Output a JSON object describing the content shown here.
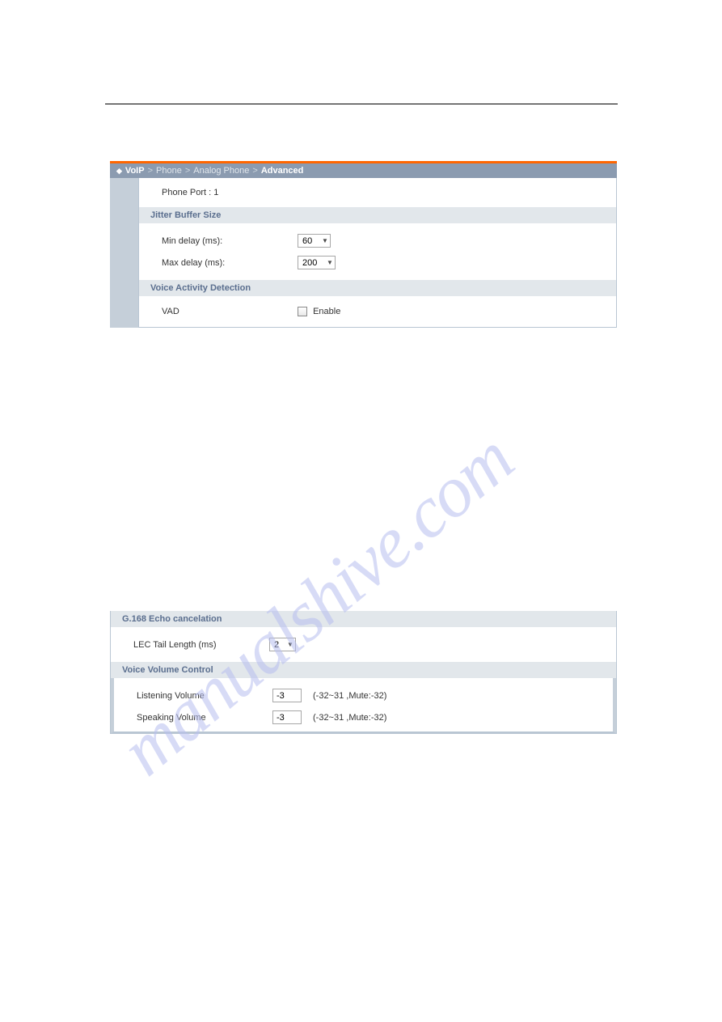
{
  "watermark": "manualshive.com",
  "breadcrumb": {
    "diamond": "◆",
    "seg1": "VoIP",
    "sep": ">",
    "seg2": "Phone",
    "seg3": "Analog Phone",
    "seg4": "Advanced"
  },
  "phone_port": {
    "label": "Phone Port : 1"
  },
  "sections": {
    "jitter": {
      "title": "Jitter Buffer Size",
      "min_delay_label": "Min delay (ms):",
      "min_delay_value": "60",
      "max_delay_label": "Max delay (ms):",
      "max_delay_value": "200"
    },
    "vad": {
      "title": "Voice Activity Detection",
      "label": "VAD",
      "enable_label": "Enable"
    },
    "echo": {
      "title": "G.168 Echo cancelation",
      "lec_label": "LEC Tail Length (ms)",
      "lec_value": "2"
    },
    "volume": {
      "title": "Voice Volume Control",
      "listening_label": "Listening Volume",
      "listening_value": "-3",
      "listening_hint": "(-32~31 ,Mute:-32)",
      "speaking_label": "Speaking Volume",
      "speaking_value": "-3",
      "speaking_hint": "(-32~31 ,Mute:-32)"
    }
  }
}
